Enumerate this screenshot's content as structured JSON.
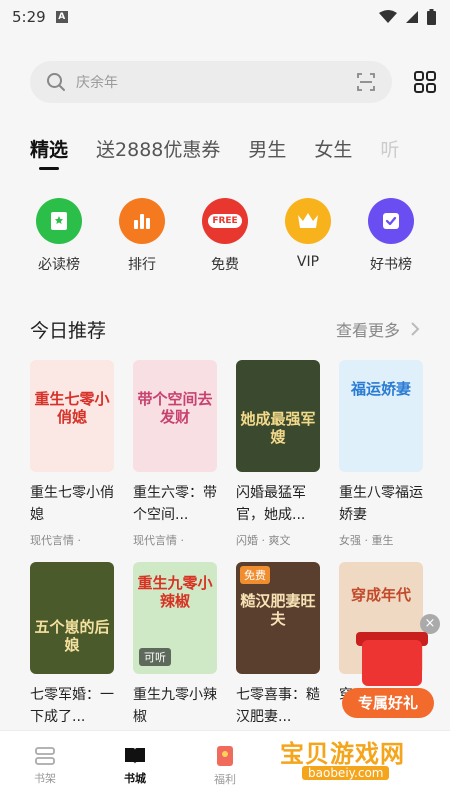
{
  "status_bar": {
    "time": "5:29",
    "a_label": "A"
  },
  "search": {
    "placeholder": "庆余年"
  },
  "tabs": [
    "精选",
    "送2888优惠券",
    "男生",
    "女生",
    "听"
  ],
  "quick_links": [
    {
      "label": "必读榜",
      "color": "#2bbf4a"
    },
    {
      "label": "排行",
      "color": "#f57a1f"
    },
    {
      "label": "免费",
      "color": "#e8372f",
      "badge": "FREE"
    },
    {
      "label": "VIP",
      "color": "#f8b21c"
    },
    {
      "label": "好书榜",
      "color": "#6a4ef2"
    }
  ],
  "section": {
    "title": "今日推荐",
    "more": "查看更多"
  },
  "books_row1": [
    {
      "title": "重生七零小俏媳",
      "meta": "现代言情 ·",
      "cover_text": "重生七零小俏媳",
      "cover_bg": "#fbe7e3",
      "cover_fg": "#d6322a"
    },
    {
      "title": "重生六零：带个空间...",
      "meta": "现代言情 ·",
      "cover_text": "带个空间去发财",
      "cover_bg": "#f7dfe4",
      "cover_fg": "#c8426f"
    },
    {
      "title": "闪婚最猛军官，她成...",
      "meta": "闪婚 · 爽文",
      "cover_text": "她成最强军嫂",
      "cover_bg": "#3b4a2f",
      "cover_fg": "#f3d98a"
    },
    {
      "title": "重生八零福运娇妻",
      "meta": "女强 · 重生",
      "cover_text": "福运娇妻",
      "cover_bg": "#dff0fa",
      "cover_fg": "#2a7bd4"
    }
  ],
  "books_row2": [
    {
      "title": "七零军婚：一下成了...",
      "cover_text": "五个崽的后娘",
      "cover_bg": "#4a5a2a",
      "cover_fg": "#f4e1a0"
    },
    {
      "title": "重生九零小辣椒",
      "cover_text": "重生九零小辣椒",
      "cover_bg": "#cfe9c7",
      "cover_fg": "#d83222",
      "listen": "可听"
    },
    {
      "title": "七零喜事：糙汉肥妻...",
      "cover_text": "糙汉肥妻旺夫",
      "cover_bg": "#5a3f2e",
      "cover_fg": "#f7e2b5",
      "badge": "免费"
    },
    {
      "title": "穿...",
      "cover_text": "穿成年代",
      "cover_bg": "#efd9c2",
      "cover_fg": "#c24a2a"
    }
  ],
  "gift": {
    "label": "专属好礼",
    "close": "×"
  },
  "bottom_nav": [
    {
      "label": "书架"
    },
    {
      "label": "书城"
    },
    {
      "label": "福利"
    }
  ],
  "watermark": {
    "text": "宝贝游戏网",
    "url": "baobeiy.com"
  }
}
